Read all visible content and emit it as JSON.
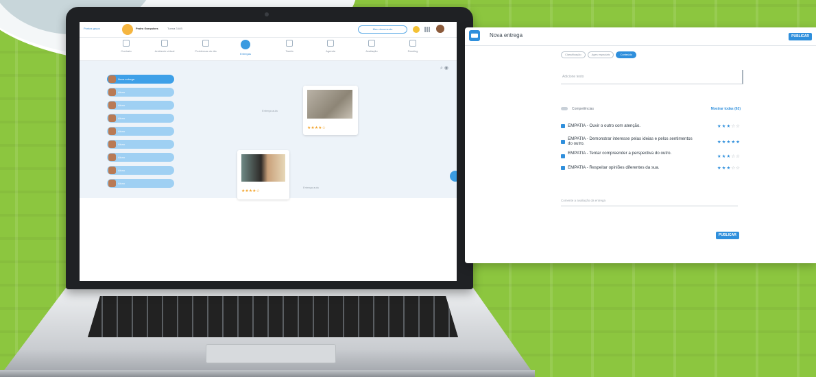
{
  "laptop_app": {
    "header_link": "Pontos grupo",
    "user_name": "Pedro Gonçalves",
    "user_sub": "Turma 3 A B",
    "nav_pill": "Meu documento",
    "tabs": [
      {
        "label": "Contrato"
      },
      {
        "label": "Ambiente virtual"
      },
      {
        "label": "Problemas do dia"
      },
      {
        "label": "Entregas"
      },
      {
        "label": "Tarefa"
      },
      {
        "label": "Agenda"
      },
      {
        "label": "Avaliação"
      },
      {
        "label": "Ranking"
      }
    ],
    "students": [
      {
        "name": "Nova entrega"
      },
      {
        "name": "Aluno"
      },
      {
        "name": "Aluno"
      },
      {
        "name": "Aluno"
      },
      {
        "name": "Aluno"
      },
      {
        "name": "Aluno"
      },
      {
        "name": "Aluno"
      },
      {
        "name": "Aluno"
      },
      {
        "name": "Aluno"
      }
    ],
    "cards": [
      {
        "label": "Entrega aula",
        "stars": 4
      },
      {
        "label": "Entrega aula",
        "stars": 4
      }
    ]
  },
  "panel": {
    "title": "Nova entrega",
    "publish_top": "PUBLICAR",
    "chips": [
      {
        "label": "Classificação",
        "active": false
      },
      {
        "label": "Ages espaciais",
        "active": false
      },
      {
        "label": "Conteúdo",
        "active": true
      }
    ],
    "text_placeholder": "Adicione texto",
    "toggle_label": "Competências",
    "show_all": "Mostrar todas (63)",
    "skills": [
      {
        "text": "EMPATIA - Ouvir o outro com atenção.",
        "rating": 3
      },
      {
        "text": "EMPATIA - Demonstrar interesse pelas ideias e pelos sentimentos do outro.",
        "rating": 5
      },
      {
        "text": "EMPATIA - Tentar compreender a perspectiva do outro.",
        "rating": 3
      },
      {
        "text": "EMPATIA - Respeitar opiniões diferentes da sua.",
        "rating": 3
      }
    ],
    "comment_placeholder": "Comente a avaliação da entrega",
    "publish_bottom": "PUBLICAR"
  },
  "colors": {
    "background_green": "#8cc63f",
    "accent_blue": "#2f8fdc",
    "star_orange": "#f2a32a"
  }
}
